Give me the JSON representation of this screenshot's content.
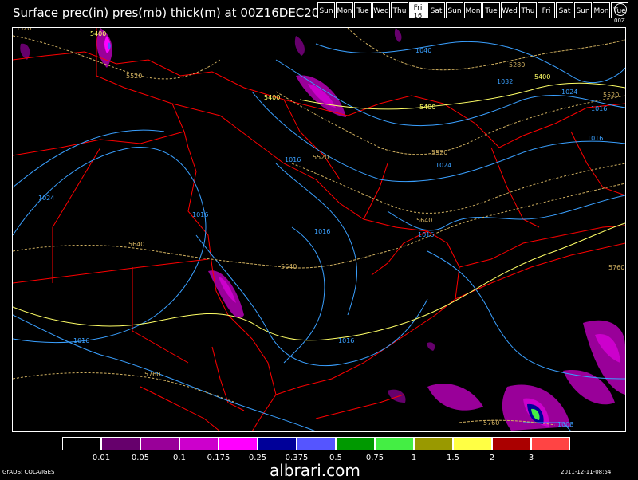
{
  "title": "Surface prec(in) pres(mb) thick(m) at 00Z16DEC2011",
  "days": [
    {
      "label": "Sun",
      "sub": ""
    },
    {
      "label": "Mon",
      "sub": ""
    },
    {
      "label": "Tue",
      "sub": ""
    },
    {
      "label": "Wed",
      "sub": ""
    },
    {
      "label": "Thu",
      "sub": ""
    },
    {
      "label": "Fri",
      "sub": "16"
    },
    {
      "label": "Sat",
      "sub": ""
    },
    {
      "label": "Sun",
      "sub": ""
    },
    {
      "label": "Mon",
      "sub": ""
    },
    {
      "label": "Tue",
      "sub": ""
    },
    {
      "label": "Wed",
      "sub": ""
    },
    {
      "label": "Thu",
      "sub": ""
    },
    {
      "label": "Fri",
      "sub": ""
    },
    {
      "label": "Sat",
      "sub": ""
    },
    {
      "label": "Sun",
      "sub": ""
    },
    {
      "label": "Mon",
      "sub": ""
    },
    {
      "label": "Tue",
      "sub": ""
    }
  ],
  "active_day_index": 5,
  "clock_label": "00Z",
  "legend": {
    "colors": [
      "#000000",
      "#66006c",
      "#990099",
      "#cc00cc",
      "#ff00ff",
      "#000099",
      "#5555ff",
      "#009900",
      "#44ee44",
      "#999900",
      "#ffff44",
      "#aa0000",
      "#ff4444"
    ],
    "labels": [
      "0.01",
      "0.05",
      "0.1",
      "0.175",
      "0.25",
      "0.375",
      "0.5",
      "0.75",
      "1",
      "1.5",
      "2",
      "3"
    ]
  },
  "pressure_labels": [
    "1040",
    "1032",
    "1024",
    "1016",
    "1024",
    "1016",
    "1016",
    "1016",
    "1016",
    "1016",
    "1016",
    "1024",
    "1016",
    "1008"
  ],
  "thickness_labels": [
    "5520",
    "5400",
    "5520",
    "5400",
    "5400",
    "5280",
    "5400",
    "5520",
    "5520",
    "5520",
    "5640",
    "5640",
    "5640",
    "5760",
    "5760",
    "5760"
  ],
  "credit": "GrADS: COLA/IGES",
  "timestamp": "2011-12-11-08:54",
  "brand": "albrari.com",
  "colors": {
    "isobar": "#3aa0ff",
    "thickness_cold": "#d0b060",
    "thickness_warm": "#ffff66",
    "boundary": "#ff0000"
  }
}
